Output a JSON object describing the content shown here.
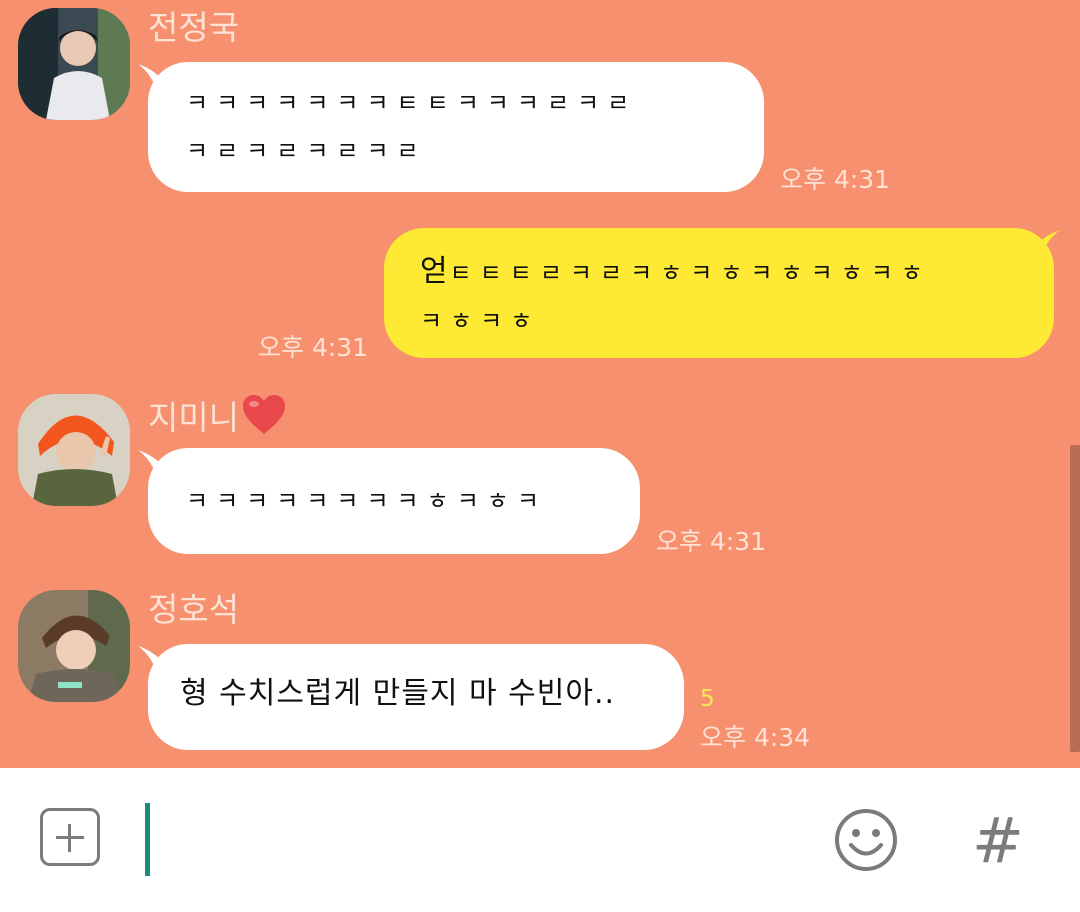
{
  "messages": [
    {
      "sender": "전정국",
      "text": "ㅋㅋㅋㅋㅋㅋㅋㅌㅌㅋㅋㅋㄹㅋㄹ\nㅋㄹㅋㄹㅋㄹㅋㄹ",
      "time": "오후 4:31"
    },
    {
      "sender": "",
      "text": "ㅌㅌㅌㄹㅋㄹㅋㅎㅋㅎㅋㅎㅋㅎㅋㅎ\nㅋㅎㅋㅎ",
      "prefix": "얻",
      "time": "오후 4:31"
    },
    {
      "sender": "지미니",
      "text": "ㅋㅋㅋㅋㅋㅋㅋㅋㅎㅋㅎㅋ",
      "time": "오후 4:31"
    },
    {
      "sender": "정호석",
      "text": "형 수치스럽게 만들지 마 수빈아..",
      "time": "오후 4:34",
      "unread": "5"
    }
  ],
  "input": {
    "placeholder": "",
    "plus_icon": "plus-icon",
    "emoji_icon": "smiley-icon",
    "hash_label": "#"
  },
  "colors": {
    "chat_bg": "#f6906e",
    "my_bubble": "#fee934",
    "their_bubble": "#ffffff",
    "cursor": "#1a8c7b"
  }
}
